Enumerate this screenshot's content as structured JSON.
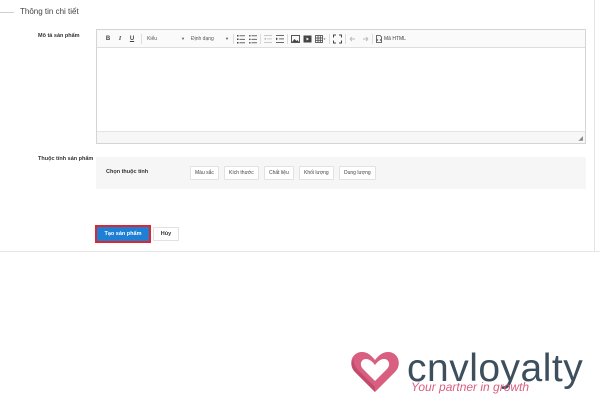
{
  "section": {
    "legend": "Thông tin chi tiết"
  },
  "description": {
    "label": "Mô tả sản phẩm",
    "toolbar": {
      "bold": "B",
      "italic": "I",
      "underline": "U",
      "style_dropdown": "Kiểu",
      "format_dropdown": "Định dạng",
      "html_source": "Mã HTML"
    }
  },
  "attributes": {
    "label": "Thuộc tính sản phẩm",
    "choose": "Chọn thuộc tính",
    "options": [
      "Màu sắc",
      "Kích thước",
      "Chất liệu",
      "Khối lượng",
      "Dung lượng"
    ]
  },
  "actions": {
    "create": "Tạo sản phẩm",
    "cancel": "Hủy"
  },
  "brand": {
    "name_part1": "cnv",
    "name_part2": "loyalty",
    "tagline": "Your partner in growth"
  },
  "colors": {
    "primary": "#1e7fd6",
    "highlight": "#e0262c",
    "brand_pink": "#d95f80",
    "brand_dark": "#3d4f5c"
  }
}
